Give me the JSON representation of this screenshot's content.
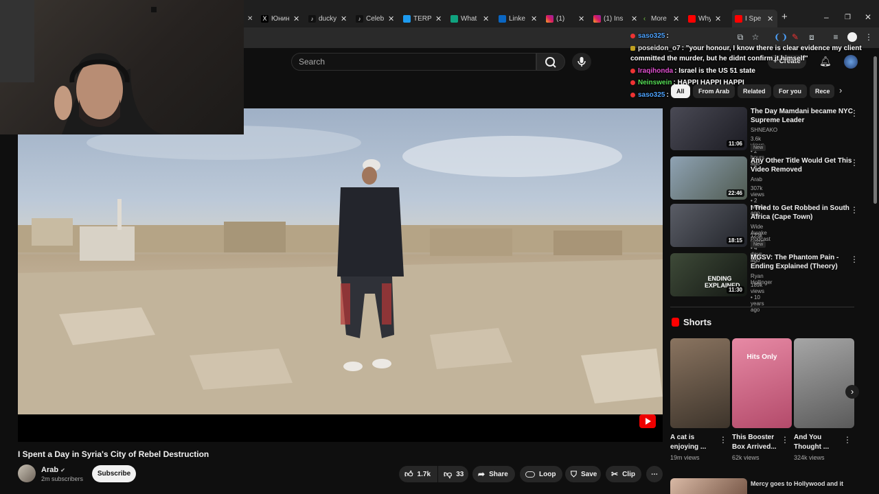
{
  "browser": {
    "tabs": [
      {
        "label": "",
        "icon": "x-icon"
      },
      {
        "label": "ducky",
        "icon": "tiktok-icon"
      },
      {
        "label": "Celeb",
        "icon": "tiktok-icon"
      },
      {
        "label": "TERPE",
        "icon": "bird-icon"
      },
      {
        "label": "What",
        "icon": "chatgpt-icon"
      },
      {
        "label": "Linke",
        "icon": "linkedin-icon"
      },
      {
        "label": "(1)",
        "icon": "instagram-icon"
      },
      {
        "label": "(1) Ins",
        "icon": "instagram-icon"
      },
      {
        "label": "More",
        "icon": "arrow-icon"
      },
      {
        "label": "Why",
        "icon": "youtube-icon"
      },
      {
        "label": "I Spe",
        "icon": "youtube-icon"
      }
    ],
    "first_tab_text": "Юнин"
  },
  "youtube": {
    "search_placeholder": "Search",
    "create_label": "Create"
  },
  "chat": [
    {
      "user": "saso325",
      "text": ":",
      "user_color": "#4da3ff",
      "badge_color": "#e33"
    },
    {
      "user": "poseidon_o7",
      "text": ": \"your honour, I know there is clear evidence my client",
      "text2": "committed the murder, but he didnt confirm it himself\"",
      "user_color": "#e6e6e6",
      "badge_color": "#c0a020"
    },
    {
      "user": "Iraqihonda",
      "text": ": Israel is the US 51 state",
      "user_color": "#e14fd0",
      "badge_color": "#e33"
    },
    {
      "user": "Neinswein",
      "text": ": HAPPI HAPPI HAPPI",
      "user_color": "#55dd55",
      "badge_color": "#e33"
    },
    {
      "user": "saso325",
      "text": ":",
      "user_color": "#4da3ff",
      "badge_color": "#e33"
    }
  ],
  "video": {
    "title": "I Spent a Day in Syria's City of Rebel Destruction",
    "channel": "Arab",
    "subscribers": "2m subscribers",
    "subscribe_label": "Subscribe",
    "likes": "1.7k",
    "dislikes": "33",
    "share_label": "Share",
    "loop_label": "Loop",
    "save_label": "Save",
    "clip_label": "Clip"
  },
  "chips": [
    "All",
    "From Arab",
    "Related",
    "For you",
    "Rece"
  ],
  "recommendations": [
    {
      "title": "The Day Mamdani became NYC Supreme Leader",
      "channel": "SHNEAKO",
      "meta": "3.6k views • 2 hours ago",
      "duration": "11:06",
      "badge": "New",
      "thumb_color": "#2a2a30"
    },
    {
      "title": "Any Other Title Would Get This Video Removed",
      "channel": "Arab",
      "meta": "307k views • 2 weeks ago",
      "duration": "22:46",
      "badge": "",
      "thumb_color": "#6f7c86"
    },
    {
      "title": "I Tried to Get Robbed in South Africa (Cape Town)",
      "channel": "Wide Awake Podcast",
      "meta": "123k views • 4 days ago",
      "duration": "18:15",
      "badge": "New",
      "thumb_color": "#3a3d44"
    },
    {
      "title": "MGSV: The Phantom Pain - Ending Explained (Theory)",
      "channel": "Ryan Hollinger",
      "meta": "189k views • 10 years ago",
      "duration": "11:30",
      "badge": "",
      "thumb_color": "#2a3128",
      "thumb_text": "ENDING EXPLAINED"
    }
  ],
  "shorts": {
    "heading": "Shorts",
    "items": [
      {
        "title": "A cat is enjoying ...",
        "views": "19m views",
        "thumb_color": "#6b5a48"
      },
      {
        "title": "This Booster Box Arrived...",
        "views": "62k views",
        "thumb_color": "#d46c88",
        "thumb_text": "Hits Only"
      },
      {
        "title": "And You Thought ...",
        "views": "324k views",
        "thumb_color": "#8a8a8a"
      }
    ]
  },
  "next_title": "Mercy goes to Hollywood and it"
}
